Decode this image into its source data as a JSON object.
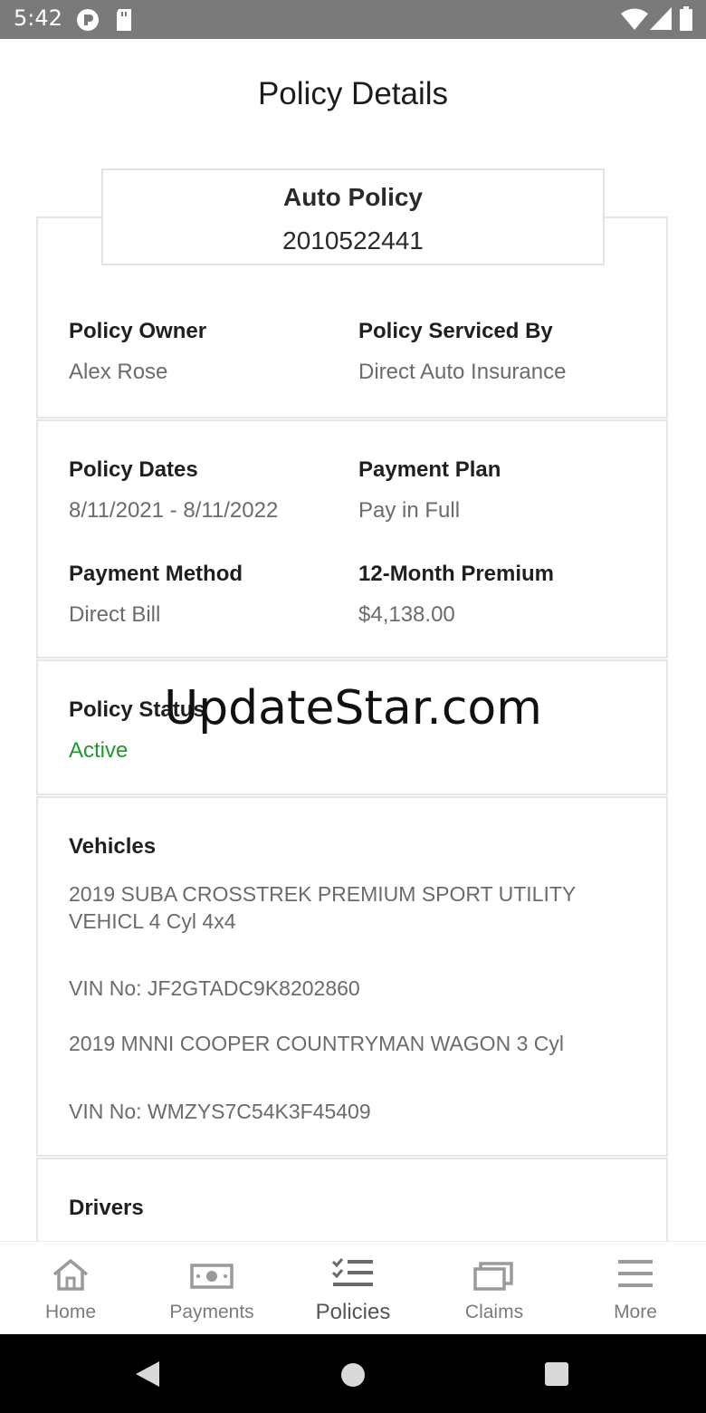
{
  "status_bar": {
    "time": "5:42"
  },
  "header": {
    "title": "Policy Details"
  },
  "policy": {
    "type": "Auto Policy",
    "number": "2010522441"
  },
  "owner_card": {
    "owner_label": "Policy Owner",
    "owner_value": "Alex Rose",
    "serviced_label": "Policy Serviced By",
    "serviced_value": "Direct Auto Insurance"
  },
  "dates_card": {
    "dates_label": "Policy Dates",
    "dates_value": "8/11/2021 - 8/11/2022",
    "plan_label": "Payment Plan",
    "plan_value": "Pay in Full",
    "method_label": "Payment Method",
    "method_value": "Direct Bill",
    "premium_label": "12-Month Premium",
    "premium_value": "$4,138.00"
  },
  "status_card": {
    "label": "Policy Status",
    "value": "Active",
    "value_color": "#1c9a2c"
  },
  "vehicles_card": {
    "label": "Vehicles",
    "vehicles": [
      {
        "name": "2019 SUBA CROSSTREK PREMIUM SPORT UTILITY VEHICL 4 Cyl 4x4",
        "vin": "VIN No: JF2GTADC9K8202860"
      },
      {
        "name": "2019 MNNI COOPER COUNTRYMAN WAGON 3 Cyl",
        "vin": "VIN No: WMZYS7C54K3F45409"
      }
    ]
  },
  "drivers_card": {
    "label": "Drivers"
  },
  "watermark": "UpdateStar.com",
  "bottom_nav": {
    "items": [
      {
        "label": "Home",
        "icon": "home-icon"
      },
      {
        "label": "Payments",
        "icon": "money-icon"
      },
      {
        "label": "Policies",
        "icon": "checklist-icon"
      },
      {
        "label": "Claims",
        "icon": "folder-icon"
      },
      {
        "label": "More",
        "icon": "menu-icon"
      }
    ],
    "selected": "Policies"
  }
}
